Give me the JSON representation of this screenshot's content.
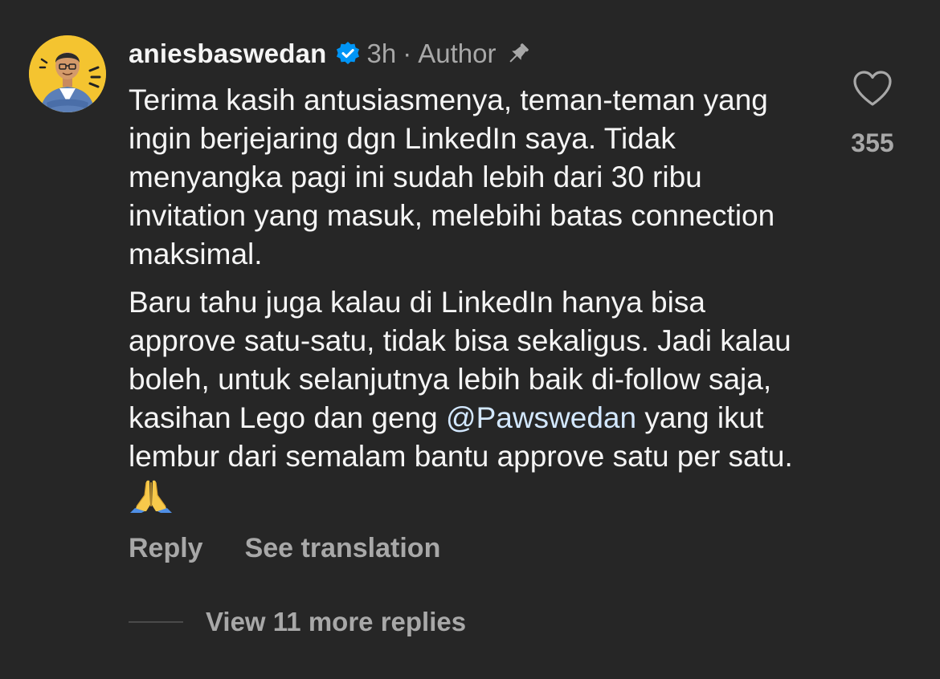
{
  "comment": {
    "username": "aniesbaswedan",
    "time": "3h",
    "separator": "·",
    "author_badge": "Author",
    "paragraph1": "Terima kasih antusiasmenya, teman-teman yang ingin berjejaring dgn LinkedIn saya. Tidak menyangka pagi ini sudah lebih dari 30 ribu invitation yang masuk, melebihi batas connection maksimal.",
    "paragraph2_start": "Baru tahu juga kalau di LinkedIn hanya bisa approve satu-satu, tidak bisa sekaligus. Jadi kalau boleh, untuk selanjutnya lebih baik di-follow saja, kasihan Lego dan geng ",
    "mention": "@Pawswedan",
    "paragraph2_end": " yang ikut lembur dari semalam bantu approve satu per satu.",
    "emoji_icon": "folded-hands-emoji"
  },
  "actions": {
    "reply_label": "Reply",
    "translation_label": "See translation"
  },
  "like": {
    "icon": "heart-icon",
    "count": "355"
  },
  "replies": {
    "label": "View 11 more replies"
  },
  "colors": {
    "background": "#262626",
    "text": "#f5f5f5",
    "secondary": "#a8a8a8",
    "verified": "#0095f6",
    "mention": "#d3e8ff",
    "avatar_bg": "#f4c430"
  }
}
